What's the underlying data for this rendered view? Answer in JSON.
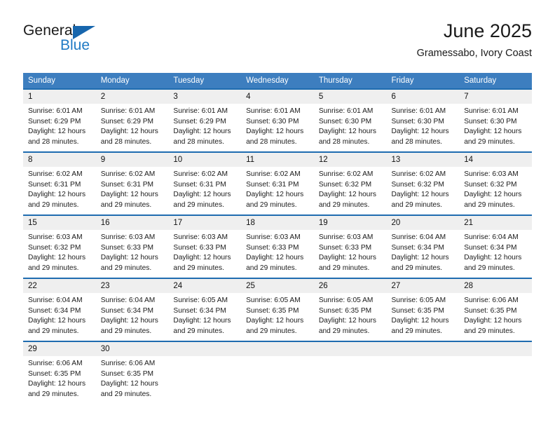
{
  "branding": {
    "logo_primary": "General",
    "logo_secondary": "Blue",
    "logo_triangle_color": "#1766ad",
    "logo_secondary_color": "#1f7ac4"
  },
  "header": {
    "title": "June 2025",
    "subtitle": "Gramessabo, Ivory Coast"
  },
  "theme": {
    "header_bg": "#3d7ebf",
    "row_border": "#1f6cb0",
    "daynum_bg": "#efefef",
    "text": "#1a1a1a"
  },
  "calendar": {
    "weekday_headers": [
      "Sunday",
      "Monday",
      "Tuesday",
      "Wednesday",
      "Thursday",
      "Friday",
      "Saturday"
    ],
    "weeks": [
      [
        {
          "day": "1",
          "sunrise": "Sunrise: 6:01 AM",
          "sunset": "Sunset: 6:29 PM",
          "daylight_1": "Daylight: 12 hours",
          "daylight_2": "and 28 minutes."
        },
        {
          "day": "2",
          "sunrise": "Sunrise: 6:01 AM",
          "sunset": "Sunset: 6:29 PM",
          "daylight_1": "Daylight: 12 hours",
          "daylight_2": "and 28 minutes."
        },
        {
          "day": "3",
          "sunrise": "Sunrise: 6:01 AM",
          "sunset": "Sunset: 6:29 PM",
          "daylight_1": "Daylight: 12 hours",
          "daylight_2": "and 28 minutes."
        },
        {
          "day": "4",
          "sunrise": "Sunrise: 6:01 AM",
          "sunset": "Sunset: 6:30 PM",
          "daylight_1": "Daylight: 12 hours",
          "daylight_2": "and 28 minutes."
        },
        {
          "day": "5",
          "sunrise": "Sunrise: 6:01 AM",
          "sunset": "Sunset: 6:30 PM",
          "daylight_1": "Daylight: 12 hours",
          "daylight_2": "and 28 minutes."
        },
        {
          "day": "6",
          "sunrise": "Sunrise: 6:01 AM",
          "sunset": "Sunset: 6:30 PM",
          "daylight_1": "Daylight: 12 hours",
          "daylight_2": "and 28 minutes."
        },
        {
          "day": "7",
          "sunrise": "Sunrise: 6:01 AM",
          "sunset": "Sunset: 6:30 PM",
          "daylight_1": "Daylight: 12 hours",
          "daylight_2": "and 29 minutes."
        }
      ],
      [
        {
          "day": "8",
          "sunrise": "Sunrise: 6:02 AM",
          "sunset": "Sunset: 6:31 PM",
          "daylight_1": "Daylight: 12 hours",
          "daylight_2": "and 29 minutes."
        },
        {
          "day": "9",
          "sunrise": "Sunrise: 6:02 AM",
          "sunset": "Sunset: 6:31 PM",
          "daylight_1": "Daylight: 12 hours",
          "daylight_2": "and 29 minutes."
        },
        {
          "day": "10",
          "sunrise": "Sunrise: 6:02 AM",
          "sunset": "Sunset: 6:31 PM",
          "daylight_1": "Daylight: 12 hours",
          "daylight_2": "and 29 minutes."
        },
        {
          "day": "11",
          "sunrise": "Sunrise: 6:02 AM",
          "sunset": "Sunset: 6:31 PM",
          "daylight_1": "Daylight: 12 hours",
          "daylight_2": "and 29 minutes."
        },
        {
          "day": "12",
          "sunrise": "Sunrise: 6:02 AM",
          "sunset": "Sunset: 6:32 PM",
          "daylight_1": "Daylight: 12 hours",
          "daylight_2": "and 29 minutes."
        },
        {
          "day": "13",
          "sunrise": "Sunrise: 6:02 AM",
          "sunset": "Sunset: 6:32 PM",
          "daylight_1": "Daylight: 12 hours",
          "daylight_2": "and 29 minutes."
        },
        {
          "day": "14",
          "sunrise": "Sunrise: 6:03 AM",
          "sunset": "Sunset: 6:32 PM",
          "daylight_1": "Daylight: 12 hours",
          "daylight_2": "and 29 minutes."
        }
      ],
      [
        {
          "day": "15",
          "sunrise": "Sunrise: 6:03 AM",
          "sunset": "Sunset: 6:32 PM",
          "daylight_1": "Daylight: 12 hours",
          "daylight_2": "and 29 minutes."
        },
        {
          "day": "16",
          "sunrise": "Sunrise: 6:03 AM",
          "sunset": "Sunset: 6:33 PM",
          "daylight_1": "Daylight: 12 hours",
          "daylight_2": "and 29 minutes."
        },
        {
          "day": "17",
          "sunrise": "Sunrise: 6:03 AM",
          "sunset": "Sunset: 6:33 PM",
          "daylight_1": "Daylight: 12 hours",
          "daylight_2": "and 29 minutes."
        },
        {
          "day": "18",
          "sunrise": "Sunrise: 6:03 AM",
          "sunset": "Sunset: 6:33 PM",
          "daylight_1": "Daylight: 12 hours",
          "daylight_2": "and 29 minutes."
        },
        {
          "day": "19",
          "sunrise": "Sunrise: 6:03 AM",
          "sunset": "Sunset: 6:33 PM",
          "daylight_1": "Daylight: 12 hours",
          "daylight_2": "and 29 minutes."
        },
        {
          "day": "20",
          "sunrise": "Sunrise: 6:04 AM",
          "sunset": "Sunset: 6:34 PM",
          "daylight_1": "Daylight: 12 hours",
          "daylight_2": "and 29 minutes."
        },
        {
          "day": "21",
          "sunrise": "Sunrise: 6:04 AM",
          "sunset": "Sunset: 6:34 PM",
          "daylight_1": "Daylight: 12 hours",
          "daylight_2": "and 29 minutes."
        }
      ],
      [
        {
          "day": "22",
          "sunrise": "Sunrise: 6:04 AM",
          "sunset": "Sunset: 6:34 PM",
          "daylight_1": "Daylight: 12 hours",
          "daylight_2": "and 29 minutes."
        },
        {
          "day": "23",
          "sunrise": "Sunrise: 6:04 AM",
          "sunset": "Sunset: 6:34 PM",
          "daylight_1": "Daylight: 12 hours",
          "daylight_2": "and 29 minutes."
        },
        {
          "day": "24",
          "sunrise": "Sunrise: 6:05 AM",
          "sunset": "Sunset: 6:34 PM",
          "daylight_1": "Daylight: 12 hours",
          "daylight_2": "and 29 minutes."
        },
        {
          "day": "25",
          "sunrise": "Sunrise: 6:05 AM",
          "sunset": "Sunset: 6:35 PM",
          "daylight_1": "Daylight: 12 hours",
          "daylight_2": "and 29 minutes."
        },
        {
          "day": "26",
          "sunrise": "Sunrise: 6:05 AM",
          "sunset": "Sunset: 6:35 PM",
          "daylight_1": "Daylight: 12 hours",
          "daylight_2": "and 29 minutes."
        },
        {
          "day": "27",
          "sunrise": "Sunrise: 6:05 AM",
          "sunset": "Sunset: 6:35 PM",
          "daylight_1": "Daylight: 12 hours",
          "daylight_2": "and 29 minutes."
        },
        {
          "day": "28",
          "sunrise": "Sunrise: 6:06 AM",
          "sunset": "Sunset: 6:35 PM",
          "daylight_1": "Daylight: 12 hours",
          "daylight_2": "and 29 minutes."
        }
      ],
      [
        {
          "day": "29",
          "sunrise": "Sunrise: 6:06 AM",
          "sunset": "Sunset: 6:35 PM",
          "daylight_1": "Daylight: 12 hours",
          "daylight_2": "and 29 minutes."
        },
        {
          "day": "30",
          "sunrise": "Sunrise: 6:06 AM",
          "sunset": "Sunset: 6:35 PM",
          "daylight_1": "Daylight: 12 hours",
          "daylight_2": "and 29 minutes."
        },
        {
          "day": "",
          "sunrise": "",
          "sunset": "",
          "daylight_1": "",
          "daylight_2": ""
        },
        {
          "day": "",
          "sunrise": "",
          "sunset": "",
          "daylight_1": "",
          "daylight_2": ""
        },
        {
          "day": "",
          "sunrise": "",
          "sunset": "",
          "daylight_1": "",
          "daylight_2": ""
        },
        {
          "day": "",
          "sunrise": "",
          "sunset": "",
          "daylight_1": "",
          "daylight_2": ""
        },
        {
          "day": "",
          "sunrise": "",
          "sunset": "",
          "daylight_1": "",
          "daylight_2": ""
        }
      ]
    ]
  }
}
